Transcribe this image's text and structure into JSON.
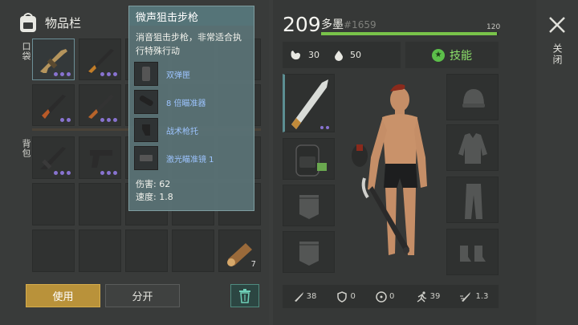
{
  "inventory": {
    "title": "物品栏",
    "pocket_label": "口袋",
    "backpack_label": "背包",
    "pocket_slots": [
      {
        "icon": "assault-rifle-icon",
        "dots": 3,
        "selected": true
      },
      {
        "icon": "rifle-icon",
        "dots": 3,
        "selected": false
      },
      {
        "icon": "assault-rifle-icon",
        "dots": 2,
        "selected": false
      },
      {
        "icon": "shotgun-icon",
        "dots": 3,
        "selected": false
      }
    ],
    "backpack_slots": [
      {
        "icon": "smg-icon",
        "dots": 3
      },
      {
        "icon": "pistol-icon",
        "dots": 3
      }
    ],
    "log_item": {
      "icon": "log-icon",
      "quantity": "7"
    }
  },
  "tooltip": {
    "title": "微声狙击步枪",
    "description": "消音狙击步枪，非常适合执行特殊行动",
    "mods": [
      {
        "name": "双弹匣",
        "icon": "magazine-icon"
      },
      {
        "name": "8 倍瞄准器",
        "icon": "scope-icon"
      },
      {
        "name": "战术枪托",
        "icon": "stock-icon"
      },
      {
        "name": "激光瞄准镜 1",
        "icon": "laser-sight-icon"
      }
    ],
    "damage": "伤害: 62",
    "speed": "速度: 1.8"
  },
  "buttons": {
    "use": "使用",
    "split": "分开"
  },
  "player": {
    "level": "209",
    "name": "多墨",
    "id": "#1659",
    "xp_max": "120",
    "xp_fraction": 0.99,
    "food": "30",
    "water": "50",
    "skills_label": "技能"
  },
  "stats": [
    {
      "icon": "attack-icon",
      "value": "38"
    },
    {
      "icon": "defense-icon",
      "value": "0"
    },
    {
      "icon": "radiation-icon",
      "value": "0"
    },
    {
      "icon": "speed-icon",
      "value": "39"
    },
    {
      "icon": "attack-speed-icon",
      "value": "1.3"
    }
  ],
  "close_label": "关闭",
  "colors": {
    "xp": "#79c34a",
    "accent_gold": "#b9923a",
    "rarity_dot": "#8873d0",
    "tooltip_bg": "#5a7376"
  }
}
